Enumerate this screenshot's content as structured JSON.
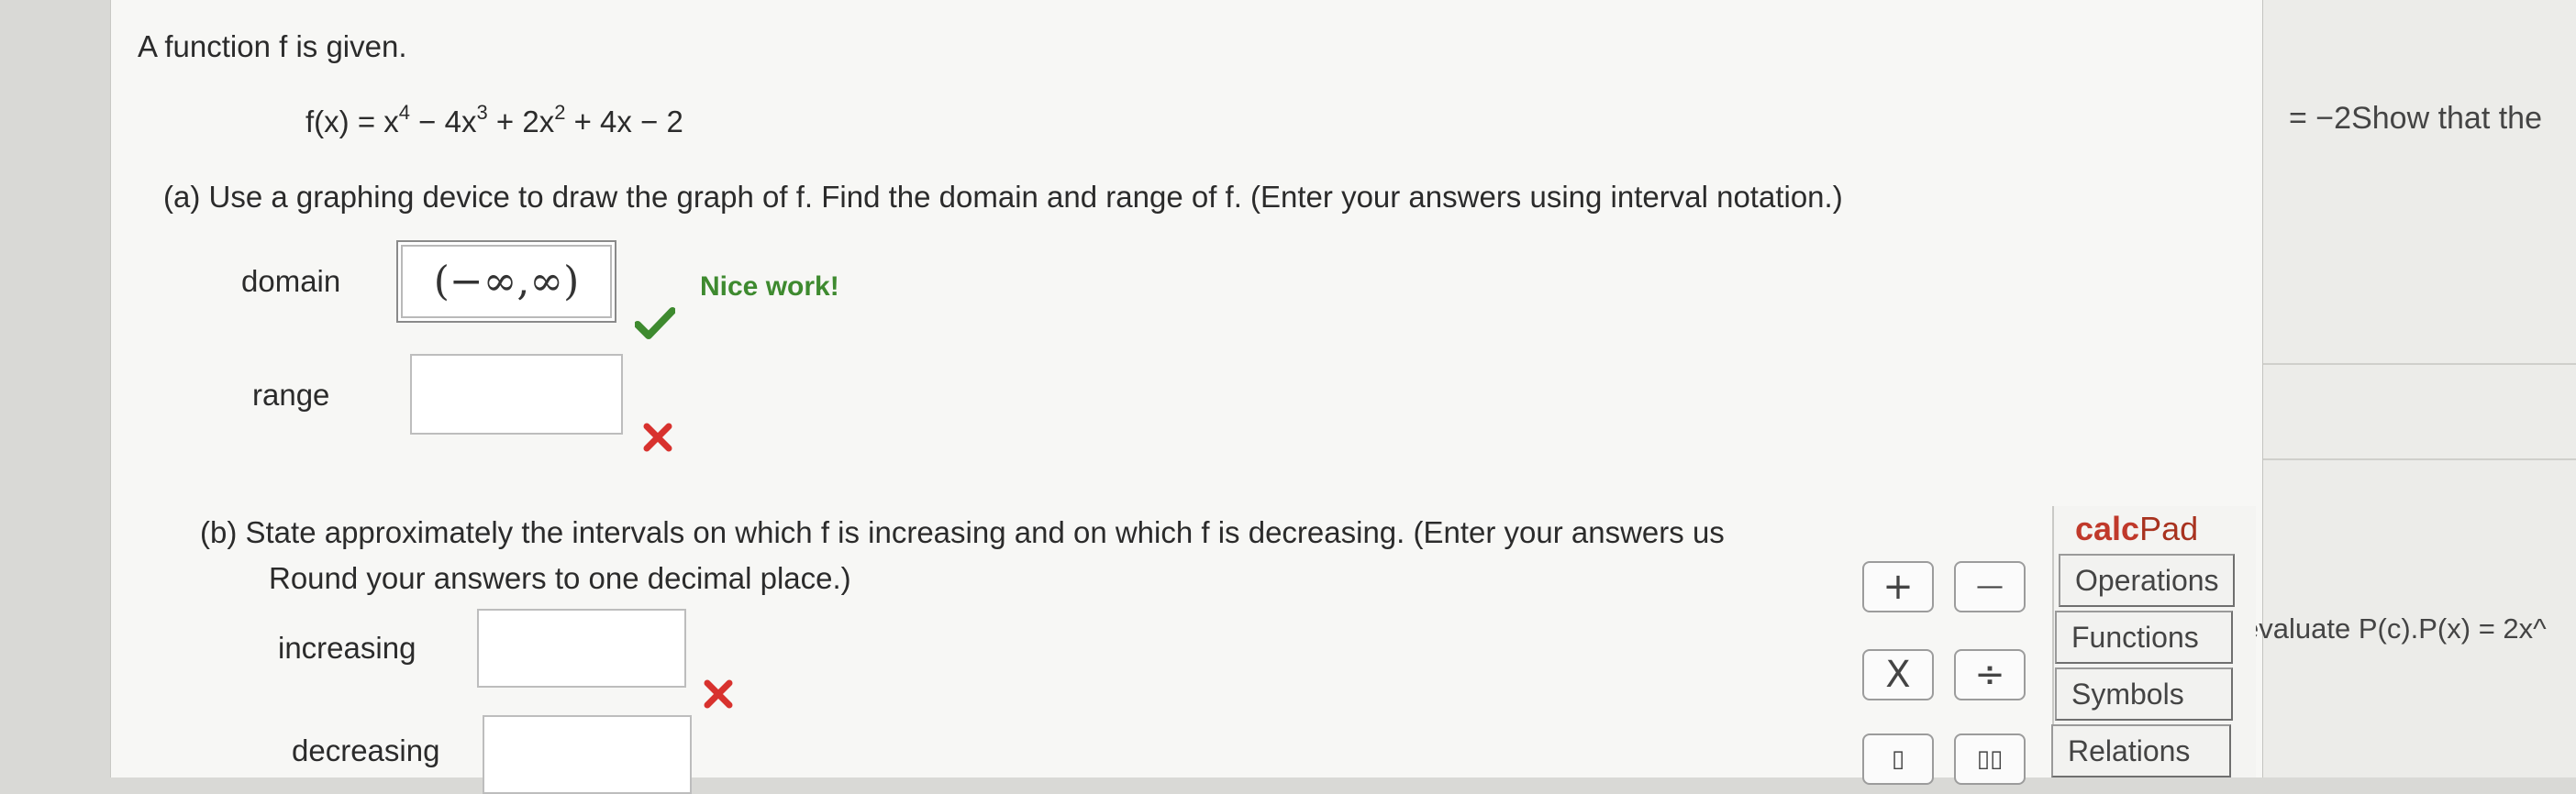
{
  "intro": "A function f is given.",
  "function": {
    "lhs": "f(x) = x",
    "p4": "4",
    "t2": " − 4x",
    "p3": "3",
    "t3": " + 2x",
    "p2": "2",
    "t4": " + 4x − 2"
  },
  "side_snippets": {
    "top": "= −2Show that the",
    "middle": "evaluate P(c).P(x) = 2x^"
  },
  "part_a": {
    "prompt": "(a)  Use a graphing device to draw the graph of f. Find the domain and range of f. (Enter your answers using interval notation.)",
    "domain_label": "domain",
    "domain_value": "(−∞,∞)",
    "domain_feedback": "Nice work!",
    "range_label": "range",
    "range_value": ""
  },
  "part_b": {
    "prompt_line1": "(b)  State approximately the intervals on which f is increasing and on which f is decreasing. (Enter your answers us",
    "prompt_line2": "Round your answers to one decimal place.)",
    "increasing_label": "increasing",
    "increasing_value": "",
    "decreasing_label": "decreasing",
    "decreasing_value": ""
  },
  "calcpad": {
    "title_a": "calc",
    "title_b": "Pad",
    "keys": {
      "plus": "+",
      "minus": "—",
      "times": "X",
      "divide": "÷",
      "fraction": "▯",
      "power": "▯▯"
    },
    "tabs": [
      "Operations",
      "Functions",
      "Symbols",
      "Relations"
    ]
  },
  "colors": {
    "correct": "#3e8a2f",
    "incorrect": "#d8322e",
    "calcpad_title": "#c0392b"
  }
}
